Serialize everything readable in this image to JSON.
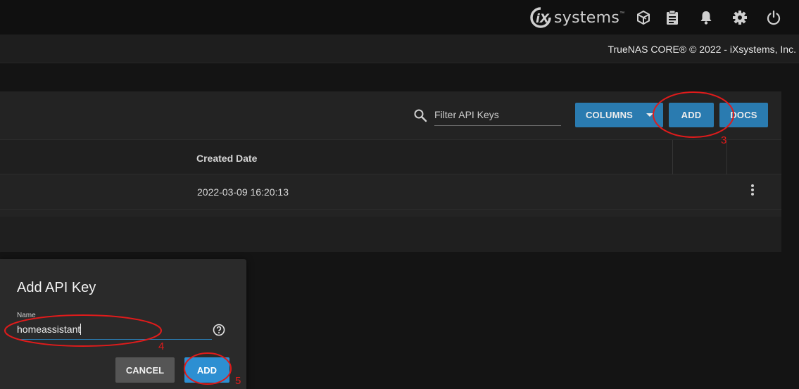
{
  "topbar": {
    "brand": {
      "mark": "iX",
      "text": "systems",
      "tm": "™"
    },
    "icons": [
      "truecommand-icon",
      "clipboard-icon",
      "bell-icon",
      "gear-icon",
      "power-icon"
    ]
  },
  "subbar": {
    "copyright": "TrueNAS CORE® © 2022 - iXsystems, Inc."
  },
  "toolbar": {
    "filter_placeholder": "Filter API Keys",
    "columns_label": "COLUMNS",
    "add_label": "ADD",
    "docs_label": "DOCS"
  },
  "table": {
    "headers": [
      "Created Date"
    ],
    "rows": [
      {
        "created": "2022-03-09 16:20:13"
      }
    ]
  },
  "dialog": {
    "title": "Add API Key",
    "name_label": "Name",
    "name_value": "homeassistant",
    "cancel_label": "CANCEL",
    "add_label": "ADD"
  },
  "annotations": {
    "step3": "3",
    "step4": "4",
    "step5": "5",
    "color": "#e01b1b"
  },
  "colors": {
    "accent": "#2a7bb0",
    "accent_bright": "#2d8fd2",
    "background": "#141414",
    "card": "#232323"
  }
}
